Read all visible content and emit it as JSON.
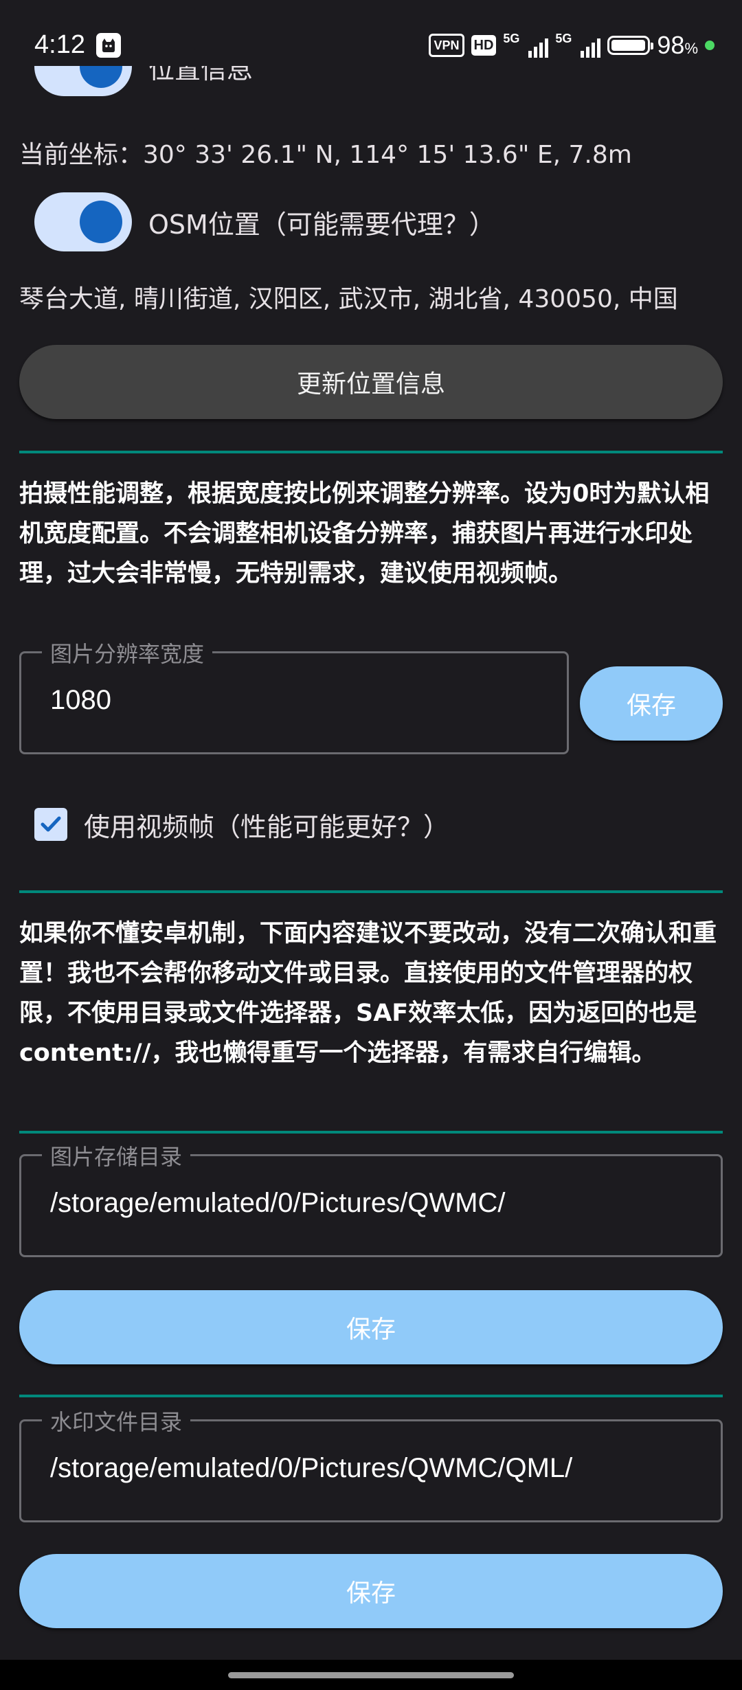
{
  "status_bar": {
    "time": "4:12",
    "vpn": "VPN",
    "hd": "HD",
    "sig1": "5G",
    "sig2": "5G",
    "battery": "98",
    "battery_unit": "%",
    "battery_level": 0.98,
    "colors": {
      "dot": "#4cd964"
    }
  },
  "location": {
    "switch1_label": "位置信息",
    "coords_text": "当前坐标：30° 33' 26.1\" N, 114° 15' 13.6\" E, 7.8m",
    "switch2_label": "OSM位置（可能需要代理？）",
    "address_text": "琴台大道, 晴川街道, 汉阳区, 武汉市, 湖北省, 430050, 中国",
    "update_button": "更新位置信息"
  },
  "performance": {
    "description": "拍摄性能调整，根据宽度按比例来调整分辨率。设为0时为默认相机宽度配置。不会调整相机设备分辨率，捕获图片再进行水印处理，过大会非常慢，无特别需求，建议使用视频帧。",
    "field_label": "图片分辨率宽度",
    "field_value": "1080",
    "save_button": "保存",
    "checkbox_label": "使用视频帧（性能可能更好？）",
    "checkbox_checked": true
  },
  "storage": {
    "warning": "如果你不懂安卓机制，下面内容建议不要改动，没有二次确认和重置！我也不会帮你移动文件或目录。直接使用的文件管理器的权限，不使用目录或文件选择器，SAF效率太低，因为返回的也是content://，我也懒得重写一个选择器，有需求自行编辑。",
    "image_dir_label": "图片存储目录",
    "image_dir_value": "/storage/emulated/0/Pictures/QWMC/",
    "image_dir_save": "保存",
    "watermark_dir_label": "水印文件目录",
    "watermark_dir_value": "/storage/emulated/0/Pictures/QWMC/QML/",
    "watermark_dir_save": "保存"
  },
  "colors": {
    "background": "#1c1b1f",
    "accent_divider": "#00897b",
    "primary_button": "#90caf9",
    "switch_track": "#d3e3fd",
    "switch_thumb": "#1565c0"
  }
}
